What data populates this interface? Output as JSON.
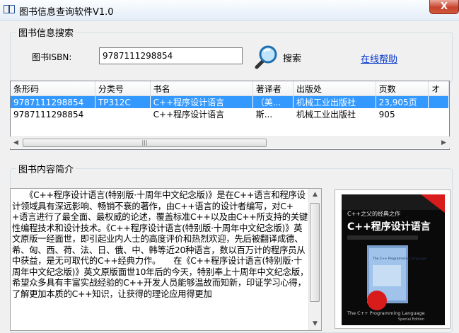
{
  "window": {
    "title": "图书信息查询软件V1.0",
    "close_label": "X"
  },
  "search_group": {
    "legend": "图书信息搜索",
    "isbn_label": "图书ISBN:",
    "isbn_value": "9787111298854",
    "search_label": "搜索",
    "help_label": "在线帮助"
  },
  "results": {
    "columns": [
      "条形码",
      "分类号",
      "书名",
      "著译者",
      "出版处",
      "页数",
      "オ"
    ],
    "rows": [
      [
        "9787111298854",
        "TP312C",
        "C++程序设计语言",
        "（美...",
        "机械工业出版社",
        "23,905页",
        ""
      ],
      [
        "9787111298854",
        "",
        "C++程序设计语言",
        "斯...",
        "机械工业出版社",
        "905",
        ""
      ]
    ],
    "selected_row": 0
  },
  "desc_group": {
    "legend": "图书内容简介",
    "text": "　　《C++程序设计语言(特别版·十周年中文纪念版)》是在C++语言和程序设计领域具有深远影响、畅销不衰的著作，由C++语言的设计者编写，对C++语言进行了最全面、最权威的论述，覆盖标准C++以及由C++所支持的关键性编程技术和设计技术。《C++程序设计语言(特别版·十周年中文纪念版)》英文原版一经面世，即引起业内人士的高度评价和热烈欢迎，先后被翻译成德、希、匈、西、荷、法、日、俄、中、韩等近20种语言，数以百万计的程序员从中获益，是无可取代的C++经典力作。　　在《C++程序设计语言(特别版·十周年中文纪念版)》英文原版面世10年后的今天，特别奉上十周年中文纪念版，希望众多具有丰富实战经验的C++开发人员能够温故而知新，印证学习心得，了解更加本质的C++知识，让获得的理论应用得更加"
  },
  "cover": {
    "top_text": "C++之父的经典之作",
    "title_text": "C++程序设计语言",
    "sub_text": "The C++ Programming Language",
    "edition_text": "Special Edition",
    "inner_text": "The C++ Programming Language",
    "colors": {
      "background": "#0a0a0a",
      "accent": "#d81b1b",
      "title": "#ffffff"
    }
  }
}
